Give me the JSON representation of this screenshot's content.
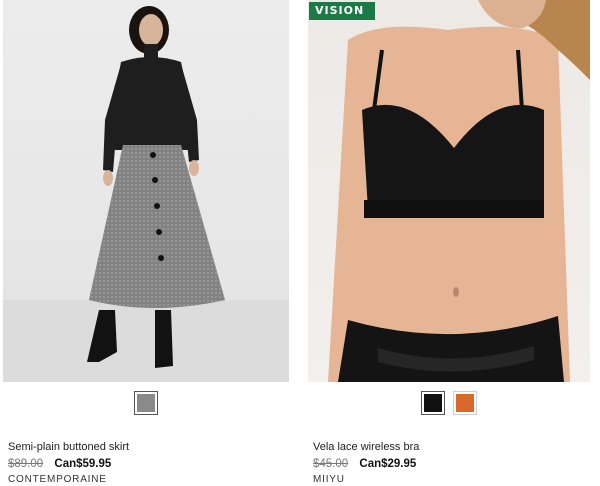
{
  "products": [
    {
      "name": "Semi-plain buttoned skirt",
      "old_price": "$89.00",
      "new_price": "Can$59.95",
      "brand": "CONTEMPORAINE",
      "swatches": [
        {
          "color": "#8a8a8a",
          "label": "grey",
          "selected": true
        }
      ]
    },
    {
      "badge": "VISION",
      "name": "Vela lace wireless bra",
      "old_price": "$45.00",
      "new_price": "Can$29.95",
      "brand": "MIIYU",
      "swatches": [
        {
          "color": "#111111",
          "label": "black",
          "selected": true
        },
        {
          "color": "#d8692a",
          "label": "orange",
          "selected": false
        }
      ]
    }
  ],
  "colors": {
    "badge_green": "#1c7a45",
    "skirt_grey": "#8a8a8a",
    "sweater_black": "#1e1e1e"
  }
}
